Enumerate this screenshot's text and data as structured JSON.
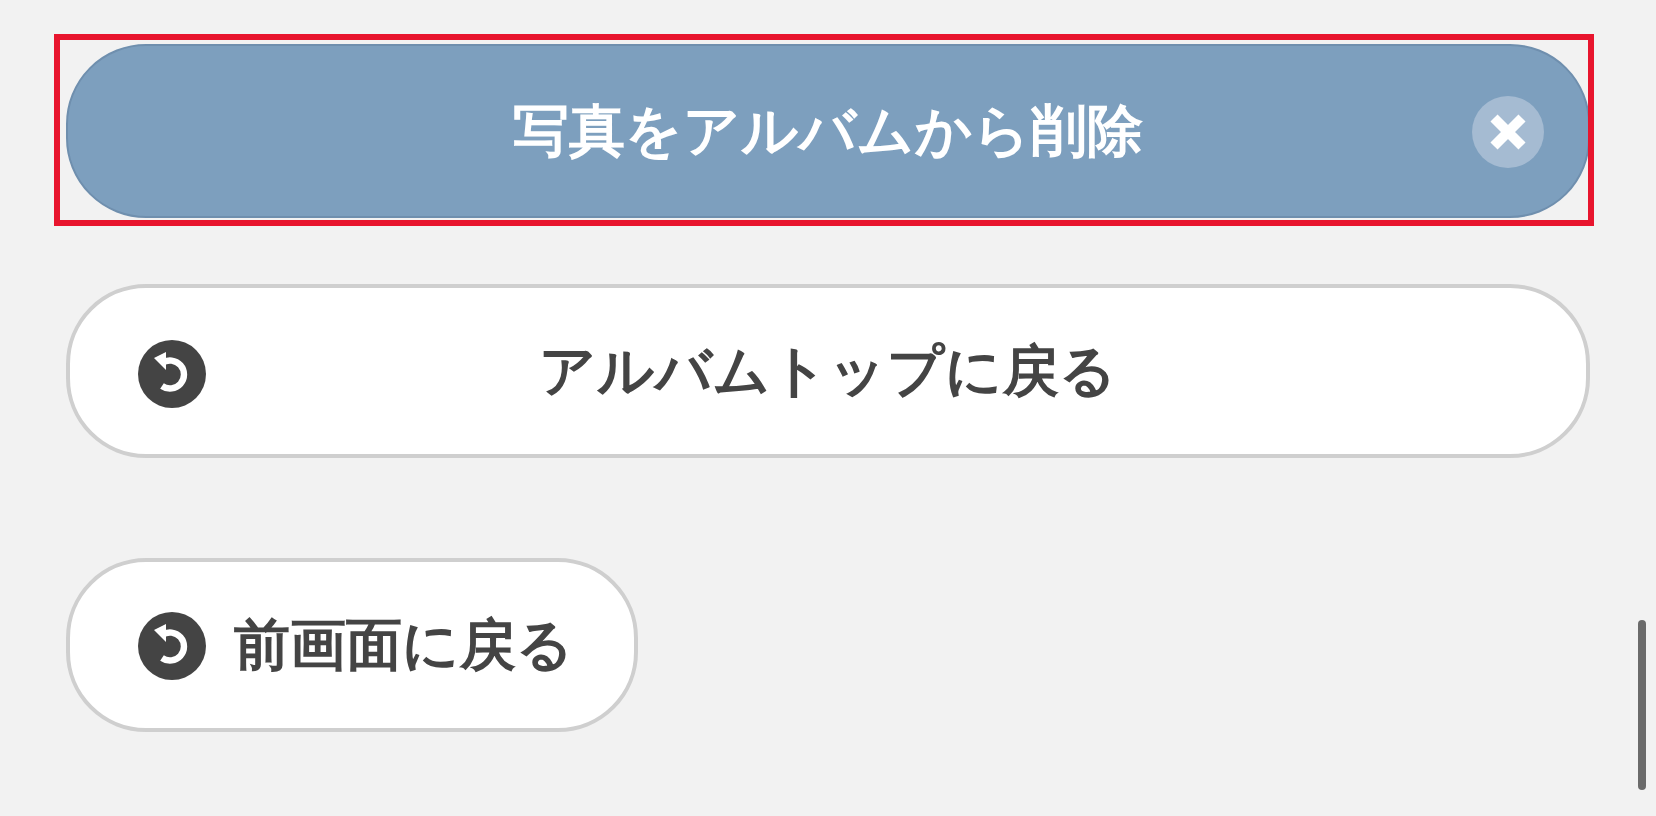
{
  "buttons": [
    {
      "kind": "delete",
      "label": "写真をアルバムから削除",
      "highlighted": true
    },
    {
      "kind": "back",
      "label": "アルバムトップに戻る",
      "highlighted": false
    },
    {
      "kind": "back",
      "label": "前画面に戻る",
      "highlighted": false
    }
  ]
}
